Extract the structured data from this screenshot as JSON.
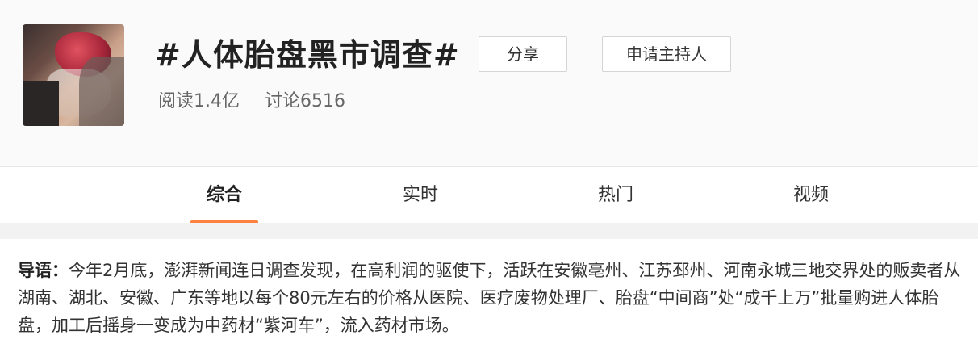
{
  "topic": {
    "title": "#人体胎盘黑市调查#",
    "reads": "阅读1.4亿",
    "discussions": "讨论6516"
  },
  "actions": {
    "share": "分享",
    "apply_host": "申请主持人"
  },
  "tabs": [
    "综合",
    "实时",
    "热门",
    "视频"
  ],
  "active_tab": "综合",
  "intro": {
    "label": "导语：",
    "text": "今年2月底，澎湃新闻连日调查发现，在高利润的驱使下，活跃在安徽亳州、江苏邳州、河南永城三地交界处的贩卖者从湖南、湖北、安徽、广东等地以每个80元左右的价格从医院、医疗废物处理厂、胎盘“中间商”处“成千上万”批量购进人体胎盘，加工后摇身一变成为中药材“紫河车”，流入药材市场。"
  },
  "colors": {
    "accent": "#ff8140",
    "background": "#fafafa"
  }
}
